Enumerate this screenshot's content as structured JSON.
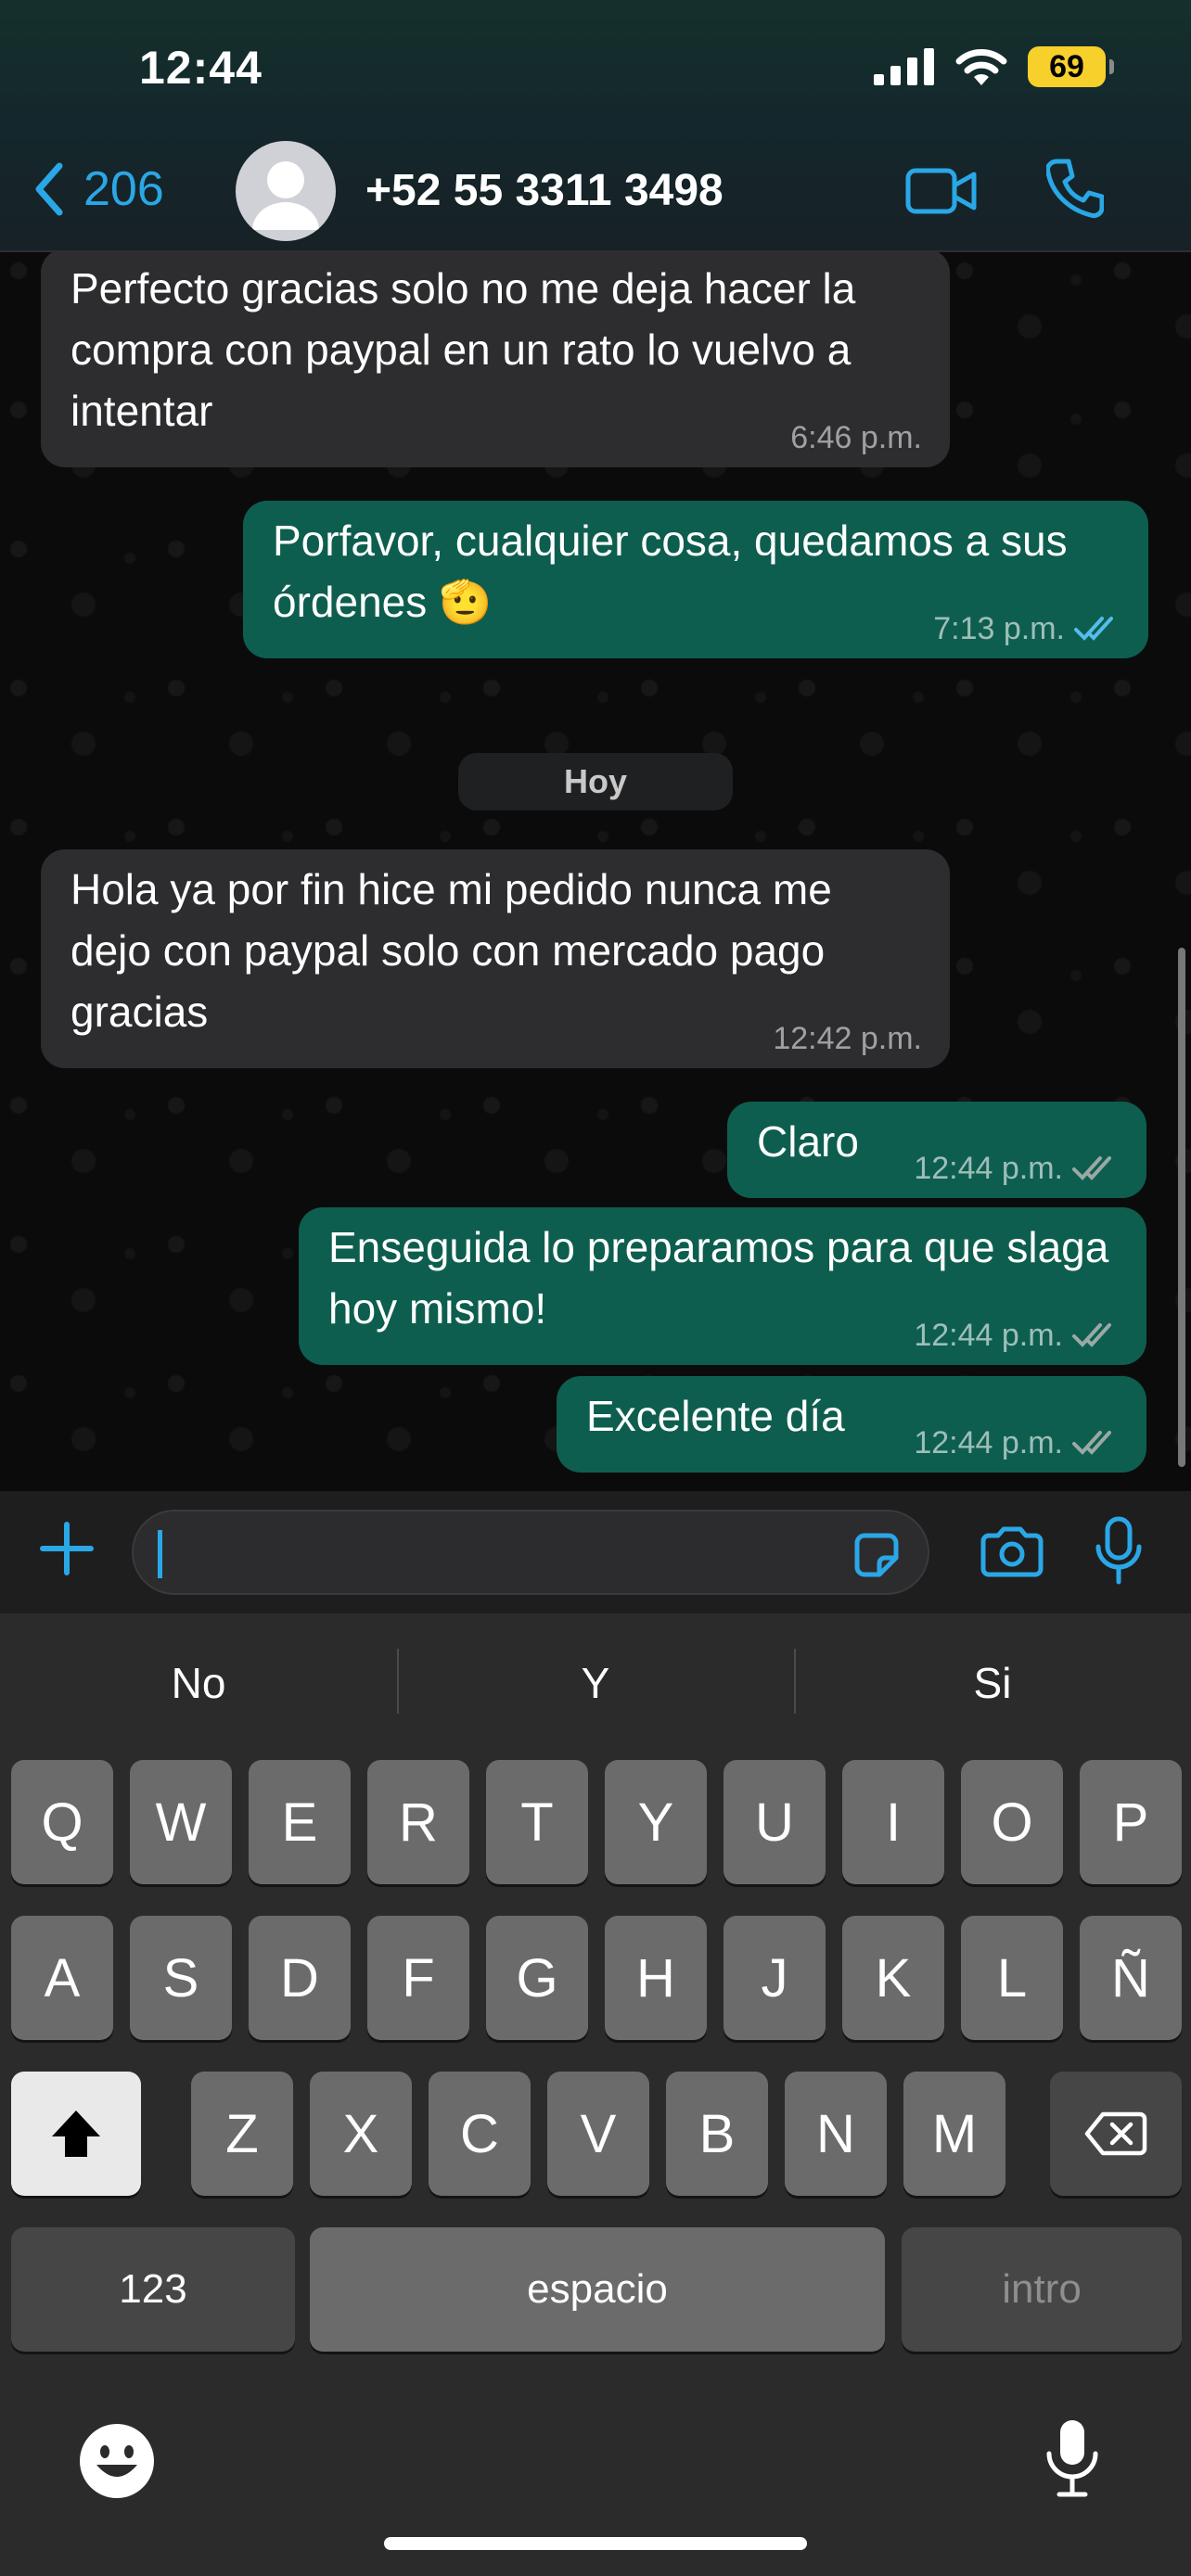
{
  "status": {
    "time": "12:44",
    "battery": "69"
  },
  "header": {
    "back_count": "206",
    "contact": "+52 55 3311 3498"
  },
  "messages": [
    {
      "dir": "in",
      "text": "Perfecto gracias solo no me deja hacer la compra con paypal en un rato lo vuelvo a intentar",
      "time": "6:46 p.m."
    },
    {
      "dir": "out",
      "text": "Porfavor, cualquier cosa, quedamos a sus órdenes 🫡",
      "time": "7:13 p.m.",
      "read": true
    },
    {
      "dir": "in",
      "text": "Hola ya por fin hice mi pedido nunca me dejo con paypal solo con mercado pago gracias",
      "time": "12:42 p.m."
    },
    {
      "dir": "out",
      "text": "Claro",
      "time": "12:44 p.m.",
      "read": false
    },
    {
      "dir": "out",
      "text": "Enseguida lo preparamos para que slaga hoy mismo!",
      "time": "12:44 p.m.",
      "read": false
    },
    {
      "dir": "out",
      "text": "Excelente día",
      "time": "12:44 p.m.",
      "read": false
    }
  ],
  "day_divider": "Hoy",
  "composer": {
    "value": ""
  },
  "keyboard": {
    "suggestions": [
      "No",
      "Y",
      "Si"
    ],
    "row1": [
      "Q",
      "W",
      "E",
      "R",
      "T",
      "Y",
      "U",
      "I",
      "O",
      "P"
    ],
    "row2": [
      "A",
      "S",
      "D",
      "F",
      "G",
      "H",
      "J",
      "K",
      "L",
      "Ñ"
    ],
    "row3": [
      "Z",
      "X",
      "C",
      "V",
      "B",
      "N",
      "M"
    ],
    "numbers_label": "123",
    "space_label": "espacio",
    "return_label": "intro"
  },
  "colors": {
    "accent": "#2aa7e6",
    "outgoing": "#0d5e4e",
    "incoming": "#2d2d2f",
    "battery": "#f7d02b"
  }
}
